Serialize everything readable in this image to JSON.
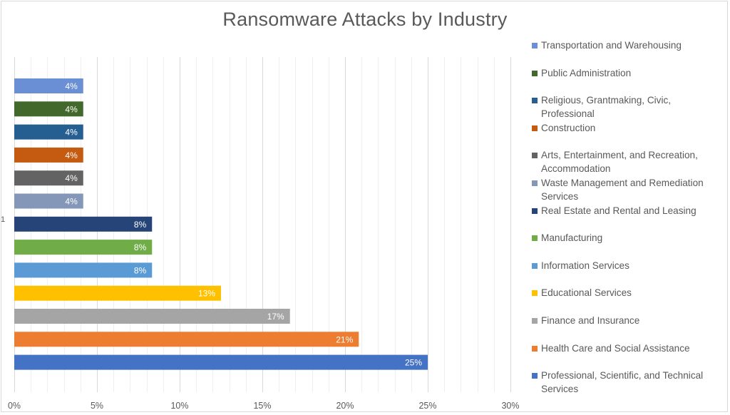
{
  "chart_data": {
    "type": "bar",
    "orientation": "horizontal",
    "title": "Ransomware Attacks by Industry",
    "xlabel": "",
    "ylabel": "",
    "category_axis_labels": [
      "1"
    ],
    "xlim": [
      0,
      0.3
    ],
    "x_ticks": [
      0,
      0.05,
      0.1,
      0.15,
      0.2,
      0.25,
      0.3
    ],
    "x_tick_labels": [
      "0%",
      "5%",
      "10%",
      "15%",
      "20%",
      "25%",
      "30%"
    ],
    "grid": {
      "major_every": 0.05,
      "minor_every": 0.01,
      "orientation": "vertical"
    },
    "legend_position": "right",
    "series": [
      {
        "name": "Transportation and Warehousing",
        "value": 0.0417,
        "label": "4%",
        "color": "#6A8FD4"
      },
      {
        "name": "Public Administration",
        "value": 0.0417,
        "label": "4%",
        "color": "#43682B"
      },
      {
        "name": "Religious, Grantmaking, Civic, Professional",
        "value": 0.0417,
        "label": "4%",
        "color": "#255E91"
      },
      {
        "name": "Construction",
        "value": 0.0417,
        "label": "4%",
        "color": "#C55A11"
      },
      {
        "name": "Arts, Entertainment, and Recreation, Accommodation",
        "value": 0.0417,
        "label": "4%",
        "color": "#636363"
      },
      {
        "name": "Waste Management and Remediation Services",
        "value": 0.0417,
        "label": "4%",
        "color": "#8497B8"
      },
      {
        "name": "Real Estate and Rental and Leasing",
        "value": 0.0833,
        "label": "8%",
        "color": "#264478"
      },
      {
        "name": "Manufacturing",
        "value": 0.0833,
        "label": "8%",
        "color": "#70AD47"
      },
      {
        "name": "Information Services",
        "value": 0.0833,
        "label": "8%",
        "color": "#5B9BD5"
      },
      {
        "name": "Educational Services",
        "value": 0.125,
        "label": "13%",
        "color": "#FFC000"
      },
      {
        "name": "Finance and Insurance",
        "value": 0.1667,
        "label": "17%",
        "color": "#A5A5A5"
      },
      {
        "name": "Health Care and Social Assistance",
        "value": 0.2083,
        "label": "21%",
        "color": "#ED7D31"
      },
      {
        "name": "Professional, Scientific, and Technical Services",
        "value": 0.25,
        "label": "25%",
        "color": "#4472C4"
      }
    ]
  }
}
